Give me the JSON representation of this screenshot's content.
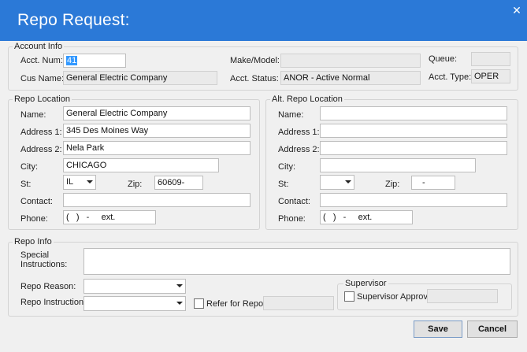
{
  "window": {
    "title": "Repo Request:",
    "close_glyph": "✕"
  },
  "account_info": {
    "legend": "Account Info",
    "acct_num_label": "Acct. Num:",
    "acct_num_value": "41",
    "cus_name_label": "Cus Name:",
    "cus_name_value": "General Electric Company",
    "make_model_label": "Make/Model:",
    "make_model_value": "",
    "acct_status_label": "Acct. Status:",
    "acct_status_value": "ANOR - Active Normal",
    "queue_label": "Queue:",
    "queue_value": "",
    "acct_type_label": "Acct. Type:",
    "acct_type_value": "OPER"
  },
  "repo_location": {
    "legend": "Repo Location",
    "name_label": "Name:",
    "name_value": "General Electric Company",
    "address1_label": "Address 1:",
    "address1_value": "345 Des Moines Way",
    "address2_label": "Address 2:",
    "address2_value": "Nela Park",
    "city_label": "City:",
    "city_value": "CHICAGO",
    "st_label": "St:",
    "st_value": "IL",
    "zip_label": "Zip:",
    "zip_value": "60609-",
    "contact_label": "Contact:",
    "contact_value": "",
    "phone_label": "Phone:",
    "phone_value": "(   )   -     ext."
  },
  "alt_repo_location": {
    "legend": "Alt. Repo Location",
    "name_label": "Name:",
    "name_value": "",
    "address1_label": "Address 1:",
    "address1_value": "",
    "address2_label": "Address 2:",
    "address2_value": "",
    "city_label": "City:",
    "city_value": "",
    "st_label": "St:",
    "st_value": "",
    "zip_label": "Zip:",
    "zip_value": "-",
    "contact_label": "Contact:",
    "contact_value": "",
    "phone_label": "Phone:",
    "phone_value": "(   )   -     ext."
  },
  "repo_info": {
    "legend": "Repo Info",
    "special_instructions_label_1": "Special",
    "special_instructions_label_2": "Instructions:",
    "special_instructions_value": "",
    "repo_reason_label": "Repo Reason:",
    "repo_reason_value": "",
    "repo_instructions_label": "Repo Instructions:",
    "repo_instructions_value": "",
    "refer_for_repo_label": "Refer for Repo",
    "refer_for_repo_checked": false,
    "refer_for_repo_value": "",
    "supervisor_legend": "Supervisor",
    "supervisor_approval_label": "Supervisor Approval",
    "supervisor_approval_checked": false,
    "supervisor_value": ""
  },
  "buttons": {
    "save_label": "Save",
    "cancel_label": "Cancel"
  },
  "colors": {
    "titlebar": "#2b79d7",
    "selection": "#3399ff"
  }
}
